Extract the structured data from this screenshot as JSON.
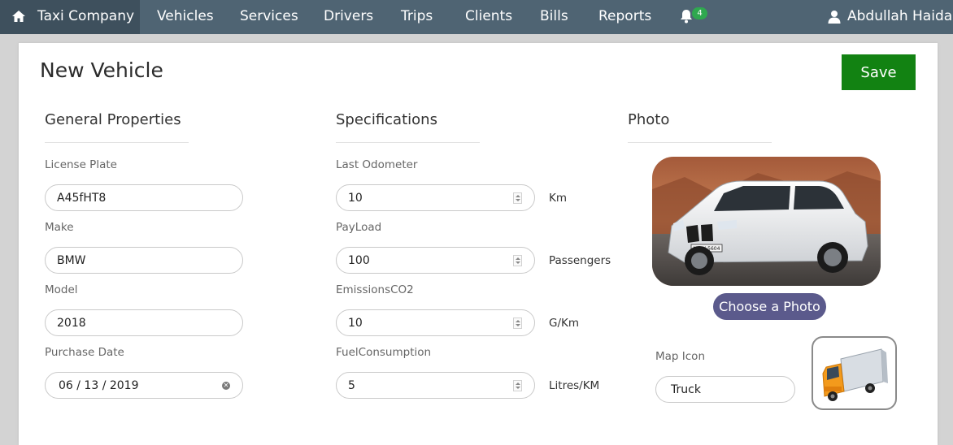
{
  "navbar": {
    "brand": "Taxi Company",
    "items": [
      "Vehicles",
      "Services",
      "Drivers",
      "Trips",
      "Clients",
      "Bills",
      "Reports"
    ],
    "notification_count": "4",
    "user_name": "Abdullah Haidar"
  },
  "page": {
    "title": "New Vehicle",
    "save_label": "Save"
  },
  "general": {
    "title": "General Properties",
    "license_plate_label": "License Plate",
    "license_plate_value": "A45fHT8",
    "make_label": "Make",
    "make_value": "BMW",
    "model_label": "Model",
    "model_value": "2018",
    "purchase_date_label": "Purchase Date",
    "purchase_date_value": "06 / 13 / 2019"
  },
  "specifications": {
    "title": "Specifications",
    "last_odometer_label": "Last Odometer",
    "last_odometer_value": "10",
    "last_odometer_unit": "Km",
    "payload_label": "PayLoad",
    "payload_value": "100",
    "payload_unit": "Passengers",
    "emissions_label": "EmissionsCO2",
    "emissions_value": "10",
    "emissions_unit": "G/Km",
    "fuel_label": "FuelConsumption",
    "fuel_value": "5",
    "fuel_unit": "Litres/KM"
  },
  "photo": {
    "title": "Photo",
    "choose_label": "Choose a Photo",
    "plate_text": "M HX 5604",
    "map_icon_label": "Map Icon",
    "map_icon_value": "Truck"
  },
  "colors": {
    "navbar": "#4f6473",
    "brand_bg": "#3e505d",
    "save_button": "#128212",
    "choose_button": "#5b5a8c",
    "badge": "#2fa84f"
  }
}
